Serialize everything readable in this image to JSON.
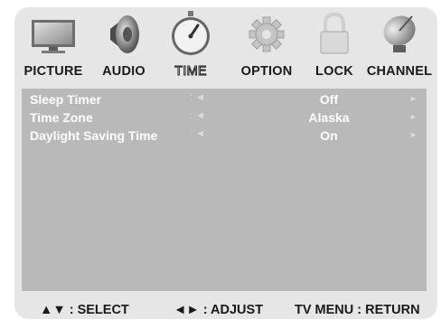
{
  "tabs": [
    {
      "label": "PICTURE",
      "icon": "monitor-icon"
    },
    {
      "label": "AUDIO",
      "icon": "speaker-icon"
    },
    {
      "label": "TIME",
      "icon": "stopwatch-icon",
      "selected": true
    },
    {
      "label": "OPTION",
      "icon": "gear-icon"
    },
    {
      "label": "LOCK",
      "icon": "padlock-icon"
    },
    {
      "label": "CHANNEL",
      "icon": "satellite-dish-icon"
    }
  ],
  "settings": [
    {
      "name": "Sleep Timer",
      "separator": ":",
      "left_arrow": "◄",
      "value": "Off",
      "right_arrow": "►"
    },
    {
      "name": "Time Zone",
      "separator": ":",
      "left_arrow": "◄",
      "value": "Alaska",
      "right_arrow": "►"
    },
    {
      "name": "Daylight Saving Time",
      "separator": ":",
      "left_arrow": "◄",
      "value": "On",
      "right_arrow": "►"
    }
  ],
  "footer": {
    "select_hint": "▲▼ : SELECT",
    "adjust_hint": "◄► : ADJUST",
    "return_hint": "TV MENU : RETURN"
  },
  "colors": {
    "background": "#e6e6e6",
    "panel": "#b9b9b9",
    "text": "#1a1a1a",
    "selected_text": "#ffffff"
  }
}
